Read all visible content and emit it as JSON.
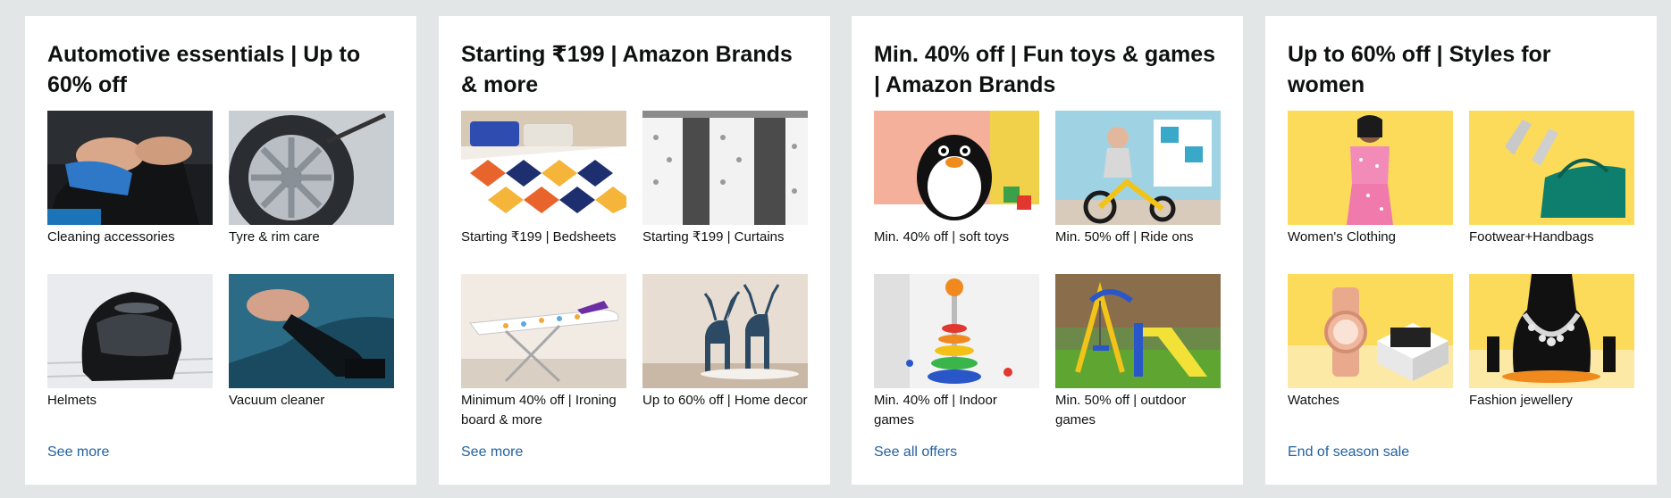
{
  "cards": [
    {
      "title": "Automotive essentials | Up to 60% off",
      "tiles": [
        {
          "label": "Cleaning accessories",
          "icon": "car-cleaning-image"
        },
        {
          "label": "Tyre & rim care",
          "icon": "tyre-rim-image"
        },
        {
          "label": "Helmets",
          "icon": "helmet-image"
        },
        {
          "label": "Vacuum cleaner",
          "icon": "vacuum-cleaner-image"
        }
      ],
      "link": "See more"
    },
    {
      "title": "Starting ₹199 | Amazon Brands & more",
      "tiles": [
        {
          "label": "Starting ₹199 | Bedsheets",
          "icon": "bedsheet-image"
        },
        {
          "label": "Starting ₹199 | Curtains",
          "icon": "curtains-image"
        },
        {
          "label": "Minimum 40% off | Ironing board & more",
          "icon": "ironing-board-image"
        },
        {
          "label": "Up to 60% off | Home decor",
          "icon": "deer-decor-image"
        }
      ],
      "link": "See more"
    },
    {
      "title": "Min. 40% off | Fun toys & games | Amazon Brands",
      "tiles": [
        {
          "label": "Min. 40% off | soft toys",
          "icon": "penguin-soft-toy-image"
        },
        {
          "label": "Min. 50% off | Ride ons",
          "icon": "tricycle-image"
        },
        {
          "label": "Min. 40% off | Indoor games",
          "icon": "stacking-toy-image"
        },
        {
          "label": "Min. 50% off | outdoor games",
          "icon": "swing-slide-image"
        }
      ],
      "link": "See all offers"
    },
    {
      "title": "Up to 60% off | Styles for women",
      "tiles": [
        {
          "label": "Women's Clothing",
          "icon": "womens-clothing-image"
        },
        {
          "label": "Footwear+Handbags",
          "icon": "footwear-handbag-image"
        },
        {
          "label": "Watches",
          "icon": "watch-image"
        },
        {
          "label": "Fashion jewellery",
          "icon": "necklace-image"
        }
      ],
      "link": "End of season sale"
    }
  ],
  "colors": {
    "page_bg": "#e3e6e6",
    "card_bg": "#ffffff",
    "link": "#2162a1",
    "text": "#0f1111",
    "fashion_yellow": "#fddb5a"
  }
}
